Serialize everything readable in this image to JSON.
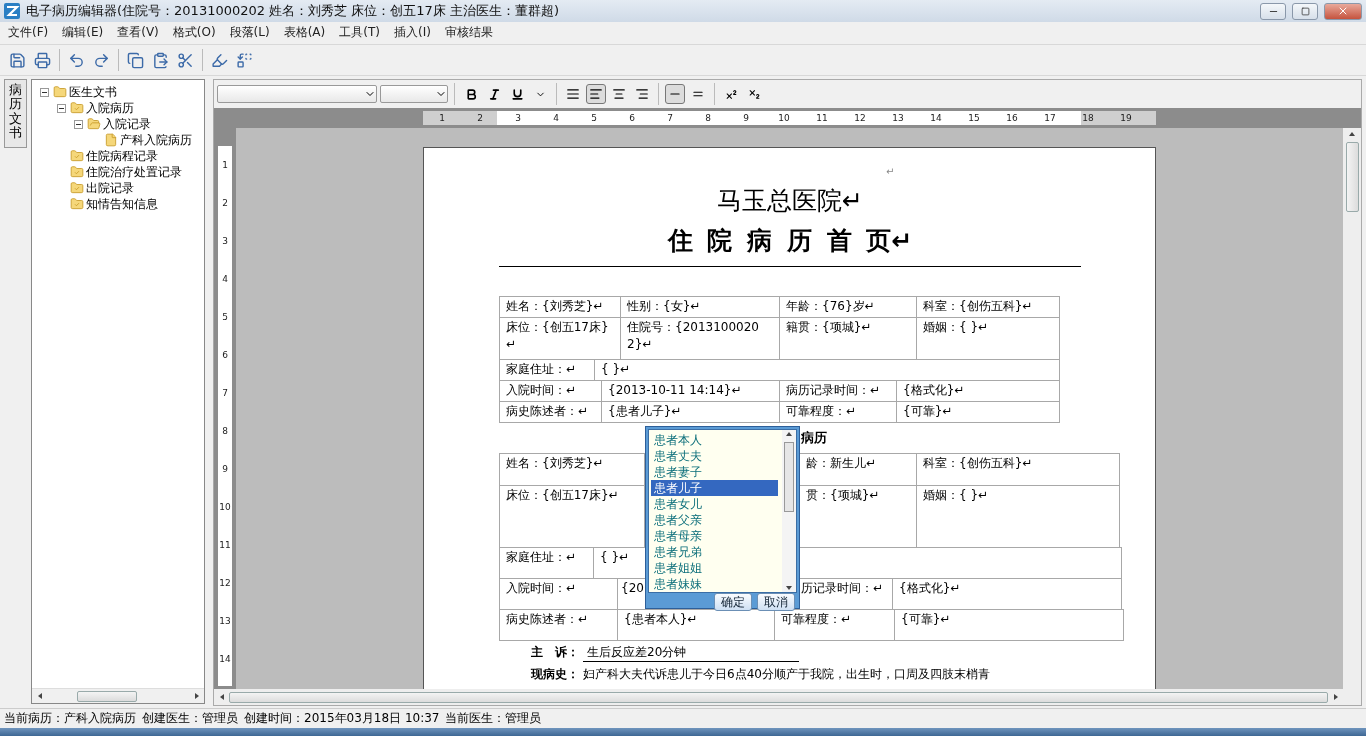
{
  "window": {
    "title": "电子病历编辑器(住院号：20131000202  姓名：刘秀芝  床位：创五17床  主治医生：董群超)"
  },
  "menu": [
    "文件(F)",
    "编辑(E)",
    "查看(V)",
    "格式(O)",
    "段落(L)",
    "表格(A)",
    "工具(T)",
    "插入(I)",
    "审核结果"
  ],
  "side_tab": {
    "label": "病历文书",
    "selected": true
  },
  "tree": [
    {
      "label": "医生文书",
      "kind": "folder",
      "expanded": true,
      "children": [
        {
          "label": "入院病历",
          "kind": "checked",
          "expanded": true,
          "children": [
            {
              "label": "入院记录",
              "kind": "open",
              "expanded": true,
              "children": [
                {
                  "label": "产科入院病历",
                  "kind": "document"
                }
              ]
            }
          ]
        },
        {
          "label": "住院病程记录",
          "kind": "checked"
        },
        {
          "label": "住院治疗处置记录",
          "kind": "checked"
        },
        {
          "label": "出院记录",
          "kind": "checked"
        },
        {
          "label": "知情告知信息",
          "kind": "checked"
        }
      ]
    }
  ],
  "format_toolbar": {
    "alignments": [
      {
        "selected": false
      },
      {
        "selected": true
      },
      {
        "selected": false
      },
      {
        "selected": false
      }
    ],
    "spacing": [
      {
        "selected": true
      },
      {
        "selected": false
      }
    ]
  },
  "ruler": {
    "h_numbers": [
      "1",
      "2",
      "3",
      "4",
      "5",
      "6",
      "7",
      "8",
      "9",
      "10",
      "11",
      "12",
      "13",
      "14",
      "15",
      "16",
      "17",
      "18",
      "19"
    ],
    "v_numbers": [
      "1",
      "2",
      "3",
      "4",
      "5",
      "6",
      "7",
      "8",
      "9",
      "10",
      "11",
      "12",
      "13",
      "14"
    ]
  },
  "document": {
    "top_mark": "↵",
    "title": "马玉总医院↵",
    "subtitle": "住 院 病 历 首 页↵",
    "table1": [
      {
        "kind": "t1-four",
        "cells": [
          "姓名：{刘秀芝}↵",
          "性别：{女}↵",
          "年龄：{76}岁↵",
          "科室：{创伤五科}↵"
        ]
      },
      {
        "kind": "t1-four-tall",
        "cells": [
          "床位：{创五17床}↵",
          "住院号：{20131000202}↵",
          "籍贯：{项城}↵",
          "婚姻：{ }↵"
        ]
      },
      {
        "kind": "t1-two",
        "cells": [
          "家庭住址：↵",
          "{ }↵"
        ]
      },
      {
        "kind": "t1-pairs",
        "cells": [
          "入院时间：↵",
          "{2013-10-11 14:14}↵",
          "病历记录时间：↵",
          "{格式化}↵"
        ]
      },
      {
        "kind": "t1-pairs",
        "cells": [
          "病史陈述者：↵",
          "{患者儿子}↵",
          "可靠程度：↵",
          "{可靠}↵"
        ]
      }
    ],
    "heading": "病历",
    "table2": [
      {
        "kind": "t2-gap",
        "cells": [
          "姓名：{刘秀芝}↵",
          "龄：新生儿↵",
          "科室：{创伤五科}↵"
        ]
      },
      {
        "kind": "t2-gap-tall",
        "cells": [
          "床位：{创五17床}↵",
          "贯：{项城}↵",
          "婚姻：{ }↵"
        ]
      },
      {
        "kind": "t2-two",
        "cells": [
          "家庭住址：↵",
          "{ }↵"
        ]
      },
      {
        "kind": "t2-cut",
        "cells": [
          "入院时间：↵",
          "{20",
          "历记录时间：↵",
          "{格式化}↵"
        ]
      },
      {
        "kind": "t2-pairs",
        "cells": [
          "病史陈述者：↵",
          "{患者本人}↵",
          "可靠程度：↵",
          "{可靠}↵"
        ]
      }
    ],
    "complaint": {
      "label": "主　诉：",
      "value": "生后反应差20分钟"
    },
    "history": {
      "label": "现病史：",
      "text": "妇产科大夫代诉患儿于今日6点40分顺产于我院，出生时，口周及四肢末梢青"
    }
  },
  "popup": {
    "options": [
      {
        "label": "患者本人",
        "selected": false
      },
      {
        "label": "患者丈夫",
        "selected": false
      },
      {
        "label": "患者妻子",
        "selected": false
      },
      {
        "label": "患者儿子",
        "selected": true
      },
      {
        "label": "患者女儿",
        "selected": false
      },
      {
        "label": "患者父亲",
        "selected": false
      },
      {
        "label": "患者母亲",
        "selected": false
      },
      {
        "label": "患者兄弟",
        "selected": false
      },
      {
        "label": "患者姐姐",
        "selected": false
      },
      {
        "label": "患者妹妹",
        "selected": false
      }
    ],
    "buttons": [
      "确定",
      "取消"
    ]
  },
  "status_bar": [
    "当前病历：产科入院病历",
    "创建医生：管理员",
    "创建时间：2015年03月18日 10:37",
    "当前医生：管理员"
  ]
}
